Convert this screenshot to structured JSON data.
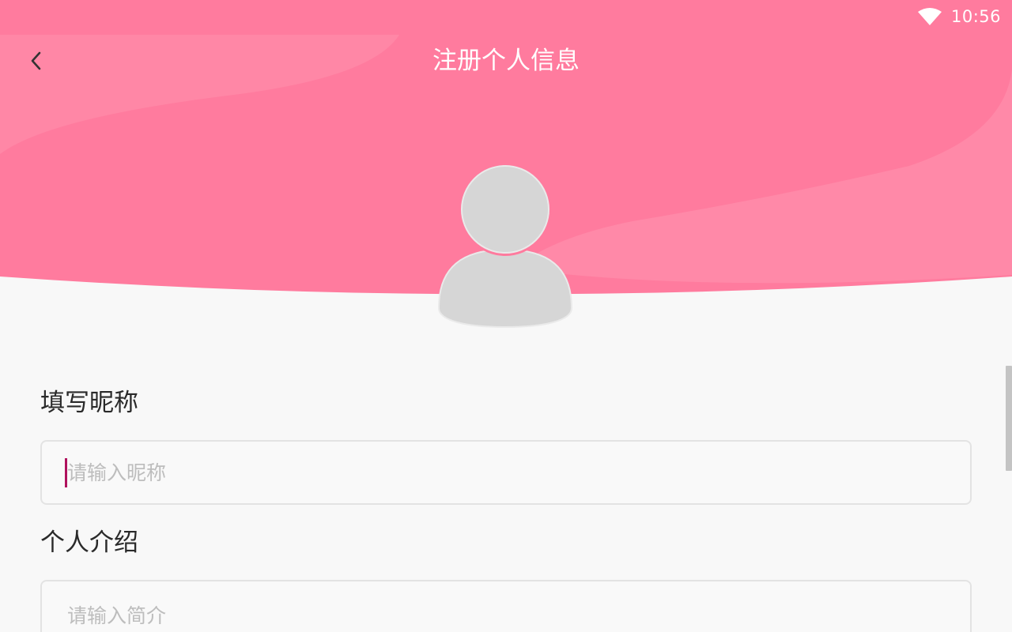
{
  "status_bar": {
    "time": "10:56",
    "wifi_icon": "wifi-icon"
  },
  "header": {
    "title": "注册个人信息",
    "back_icon": "chevron-left-icon"
  },
  "avatar": {
    "icon": "user-avatar-placeholder-icon"
  },
  "nickname": {
    "label": "填写昵称",
    "placeholder": "请输入昵称",
    "value": ""
  },
  "intro": {
    "label": "个人介绍",
    "placeholder": "请输入简介",
    "value": ""
  },
  "colors": {
    "header_pink": "#ff7b9e",
    "header_pink_light": "#ff89a8",
    "background": "#f8f8f8",
    "caret": "#b0125e",
    "avatar_gray": "#d6d6d6"
  }
}
